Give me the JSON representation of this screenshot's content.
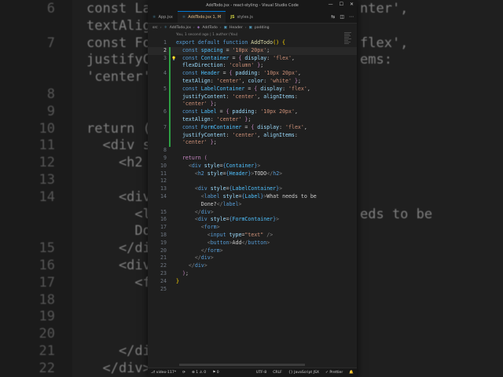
{
  "background": {
    "lines": [
      {
        "num": "6",
        "code": "const Lab",
        "right": "nter',"
      },
      {
        "num": "",
        "code": "textAlig",
        "right": ""
      },
      {
        "num": "7",
        "code": "const For",
        "right": "flex',"
      },
      {
        "num": "",
        "code": "justifyC",
        "right": "ems:"
      },
      {
        "num": "",
        "code": "'center'",
        "right": ""
      },
      {
        "num": "8",
        "code": "",
        "right": ""
      },
      {
        "num": "9",
        "code": "",
        "right": ""
      },
      {
        "num": "10",
        "code": "return (",
        "right": ""
      },
      {
        "num": "11",
        "code": "  <div s",
        "right": ""
      },
      {
        "num": "12",
        "code": "    <h2",
        "right": ""
      },
      {
        "num": "13",
        "code": "",
        "right": ""
      },
      {
        "num": "14",
        "code": "    <div",
        "right": ""
      },
      {
        "num": "",
        "code": "      <l",
        "right": "eds to be"
      },
      {
        "num": "",
        "code": "      Do",
        "right": ""
      },
      {
        "num": "15",
        "code": "    </di",
        "right": ""
      },
      {
        "num": "16",
        "code": "    <div",
        "right": ""
      },
      {
        "num": "17",
        "code": "      <f",
        "right": ""
      },
      {
        "num": "18",
        "code": "",
        "right": ""
      },
      {
        "num": "19",
        "code": "",
        "right": ""
      },
      {
        "num": "20",
        "code": "",
        "right": ""
      },
      {
        "num": "21",
        "code": "    </di",
        "right": ""
      },
      {
        "num": "22",
        "code": "  </div>",
        "right": ""
      }
    ]
  },
  "window": {
    "title": "AddTodo.jsx - react-styling - Visual Studio Code",
    "tabs": [
      {
        "icon": "⚛",
        "label": "App.jsx",
        "active": false
      },
      {
        "icon": "⚛",
        "label": "AddTodo.jsx 1, M",
        "active": true
      },
      {
        "icon": "JS",
        "label": "styles.js",
        "active": false
      }
    ],
    "breadcrumb": [
      "src",
      "AddTodo.jsx",
      "AddTodo",
      "Header",
      "padding"
    ],
    "blame": "You, 1 second ago | 1 author (You)"
  },
  "code_lines": [
    {
      "n": "1",
      "h": "<span class='k'>export default function</span> <span class='f'>AddTodo</span><span class='b'>()</span> <span class='b'>{</span>"
    },
    {
      "n": "2",
      "h": "  <span class='k'>const</span> <span class='v'>spacing</span> = <span class='s'>'10px 20px'</span>;",
      "cur": true
    },
    {
      "n": "3",
      "h": "  <span class='k'>const</span> <span class='v'>Container</span> = <span class='c'>{</span> <span class='p'>display</span>: <span class='s'>'flex'</span>,"
    },
    {
      "n": "",
      "h": "  <span class='p'>flexDirection</span>: <span class='s'>'column'</span> <span class='c'>}</span>;"
    },
    {
      "n": "4",
      "h": "  <span class='k'>const</span> <span class='v'>Header</span> = <span class='c'>{</span> <span class='p'>padding</span>: <span class='s'>'10px 20px'</span>,"
    },
    {
      "n": "",
      "h": "  <span class='p'>textAlign</span>: <span class='s'>'center'</span>, <span class='p'>color</span>: <span class='s'>'white'</span> <span class='c'>}</span>;"
    },
    {
      "n": "5",
      "h": "  <span class='k'>const</span> <span class='v'>LabelContainer</span> = <span class='c'>{</span> <span class='p'>display</span>: <span class='s'>'flex'</span>,"
    },
    {
      "n": "",
      "h": "  <span class='p'>justifyContent</span>: <span class='s'>'center'</span>, <span class='p'>alignItems</span>:"
    },
    {
      "n": "",
      "h": "  <span class='s'>'center'</span> <span class='c'>}</span>;"
    },
    {
      "n": "6",
      "h": "  <span class='k'>const</span> <span class='v'>Label</span> = <span class='c'>{</span> <span class='p'>padding</span>: <span class='s'>'10px 20px'</span>,"
    },
    {
      "n": "",
      "h": "  <span class='p'>textAlign</span>: <span class='s'>'center'</span> <span class='c'>}</span>;"
    },
    {
      "n": "7",
      "h": "  <span class='k'>const</span> <span class='v'>FormContainer</span> = <span class='c'>{</span> <span class='p'>display</span>: <span class='s'>'flex'</span>,"
    },
    {
      "n": "",
      "h": "  <span class='p'>justifyContent</span>: <span class='s'>'center'</span>, <span class='p'>alignItems</span>:"
    },
    {
      "n": "",
      "h": "  <span class='s'>'center'</span> <span class='c'>}</span>;"
    },
    {
      "n": "8",
      "h": ""
    },
    {
      "n": "9",
      "h": "  <span class='c'>return</span> <span class='c'>(</span>"
    },
    {
      "n": "10",
      "h": "    <span class='tg'>&lt;</span><span class='k'>div</span> <span class='p'>style</span>=<span class='k'>{</span><span class='v'>Container</span><span class='k'>}</span><span class='tg'>&gt;</span>"
    },
    {
      "n": "11",
      "h": "      <span class='tg'>&lt;</span><span class='k'>h2</span> <span class='p'>style</span>=<span class='k'>{</span><span class='v'>Header</span><span class='k'>}</span><span class='tg'>&gt;</span>TODO<span class='tg'>&lt;/</span><span class='k'>h2</span><span class='tg'>&gt;</span>"
    },
    {
      "n": "12",
      "h": ""
    },
    {
      "n": "13",
      "h": "      <span class='tg'>&lt;</span><span class='k'>div</span> <span class='p'>style</span>=<span class='k'>{</span><span class='v'>LabelContainer</span><span class='k'>}</span><span class='tg'>&gt;</span>"
    },
    {
      "n": "14",
      "h": "        <span class='tg'>&lt;</span><span class='k'>label</span> <span class='p'>style</span>=<span class='k'>{</span><span class='v'>Label</span><span class='k'>}</span><span class='tg'>&gt;</span>What needs to be"
    },
    {
      "n": "",
      "h": "        Done?<span class='tg'>&lt;/</span><span class='k'>label</span><span class='tg'>&gt;</span>"
    },
    {
      "n": "15",
      "h": "      <span class='tg'>&lt;/</span><span class='k'>div</span><span class='tg'>&gt;</span>"
    },
    {
      "n": "16",
      "h": "      <span class='tg'>&lt;</span><span class='k'>div</span> <span class='p'>style</span>=<span class='k'>{</span><span class='v'>FormContainer</span><span class='k'>}</span><span class='tg'>&gt;</span>"
    },
    {
      "n": "17",
      "h": "        <span class='tg'>&lt;</span><span class='k'>form</span><span class='tg'>&gt;</span>"
    },
    {
      "n": "18",
      "h": "          <span class='tg'>&lt;</span><span class='k'>input</span> <span class='p'>type</span>=<span class='s'>\"text\"</span> <span class='tg'>/&gt;</span>"
    },
    {
      "n": "19",
      "h": "          <span class='tg'>&lt;</span><span class='k'>button</span><span class='tg'>&gt;</span>Add<span class='tg'>&lt;/</span><span class='k'>button</span><span class='tg'>&gt;</span>"
    },
    {
      "n": "20",
      "h": "        <span class='tg'>&lt;/</span><span class='k'>form</span><span class='tg'>&gt;</span>"
    },
    {
      "n": "21",
      "h": "      <span class='tg'>&lt;/</span><span class='k'>div</span><span class='tg'>&gt;</span>"
    },
    {
      "n": "22",
      "h": "    <span class='tg'>&lt;/</span><span class='k'>div</span><span class='tg'>&gt;</span>"
    },
    {
      "n": "23",
      "h": "  <span class='c'>)</span>;"
    },
    {
      "n": "24",
      "h": "<span class='b'>}</span>"
    },
    {
      "n": "25",
      "h": ""
    }
  ],
  "status": {
    "branch": "video-117*",
    "sync": "⟳",
    "errors": "⊗ 1 ⚠ 0",
    "ports": "⚑ 0",
    "encoding": "UTF-8",
    "eol": "CRLF",
    "language": "{} JavaScript JSX",
    "prettier": "✓ Prettier",
    "bell": "🔔"
  },
  "colors": {
    "editor_bg": "#1f1f1f",
    "accent": "#0078d4",
    "git_added": "#2ea043"
  }
}
